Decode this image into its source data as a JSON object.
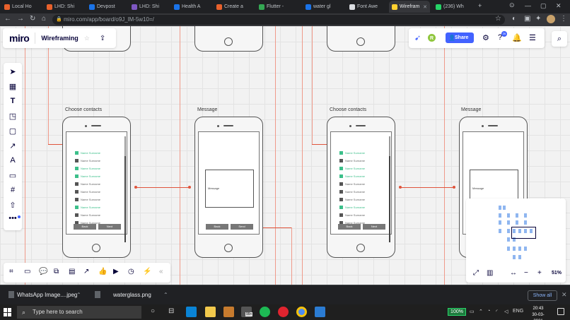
{
  "browser": {
    "tabs": [
      {
        "label": "Local Ho",
        "color": "#e8612c"
      },
      {
        "label": "LHD: Shi",
        "color": "#e8612c"
      },
      {
        "label": "Devpost",
        "color": "#1a73e8"
      },
      {
        "label": "LHD: Shi",
        "color": "#7e57c2"
      },
      {
        "label": "Health A",
        "color": "#1a73e8"
      },
      {
        "label": "Create a",
        "color": "#e8612c"
      },
      {
        "label": "Flutter -",
        "color": "#34a853"
      },
      {
        "label": "water gl",
        "color": "#1a73e8"
      },
      {
        "label": "Font Awe",
        "color": "#dadce0"
      },
      {
        "label": "Wirefram",
        "color": "#ffd02f"
      },
      {
        "label": "(236) Wh",
        "color": "#25d366"
      }
    ],
    "new_tab": "+",
    "url": "miro.com/app/board/o9J_lM-5w10=/",
    "url_host": "miro.com"
  },
  "miro": {
    "logo": "miro",
    "board_title": "Wireframing",
    "user_initial": "R",
    "share_label": "Share",
    "notifications_badge": "26",
    "zoom": "51%",
    "accent": "#4262ff"
  },
  "board": {
    "frames": [
      {
        "title": "Choose contacts"
      },
      {
        "title": "Message"
      },
      {
        "title": "Choose contacts"
      },
      {
        "title": "Message"
      }
    ],
    "contact_label": "Name Surname",
    "button_back": "Back",
    "button_next": "Next",
    "button_send": "Send",
    "message_placeholder": "Message"
  },
  "downloads": {
    "items": [
      {
        "name": "WhatsApp Image....jpeg"
      },
      {
        "name": "waterglass.png"
      }
    ],
    "show_all": "Show all"
  },
  "taskbar": {
    "search_placeholder": "Type here to search",
    "battery": "100%",
    "language": "ENG",
    "time": "20:43",
    "date": "30-03-2021",
    "badge": "99+"
  }
}
